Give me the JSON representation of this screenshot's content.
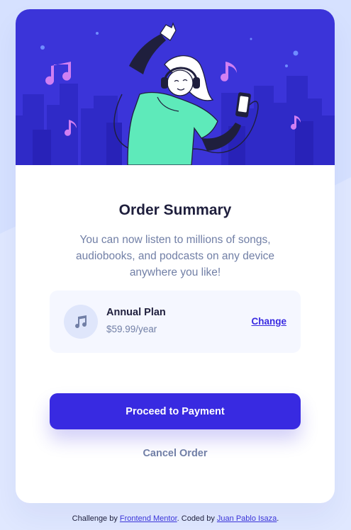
{
  "colors": {
    "background": "#e0e8ff",
    "hero_background": "#3b34d9",
    "accent": "#382ae1",
    "heading_text": "#1f1f3d",
    "muted_text": "#717fa6",
    "plan_panel": "#f5f7ff"
  },
  "hero": {
    "illustration": "woman-dancing-with-headphones"
  },
  "summary": {
    "title": "Order Summary",
    "description": "You can now listen to millions of songs, audiobooks, and podcasts on any device anywhere you like!"
  },
  "plan": {
    "icon": "music-note-icon",
    "name": "Annual Plan",
    "price": "$59.99/year",
    "change_label": "Change"
  },
  "actions": {
    "proceed_label": "Proceed to Payment",
    "cancel_label": "Cancel Order"
  },
  "attribution": {
    "prefix": "Challenge by ",
    "challenge_link": "Frontend Mentor",
    "middle": ". Coded by ",
    "author_link": "Juan Pablo Isaza",
    "suffix": "."
  }
}
